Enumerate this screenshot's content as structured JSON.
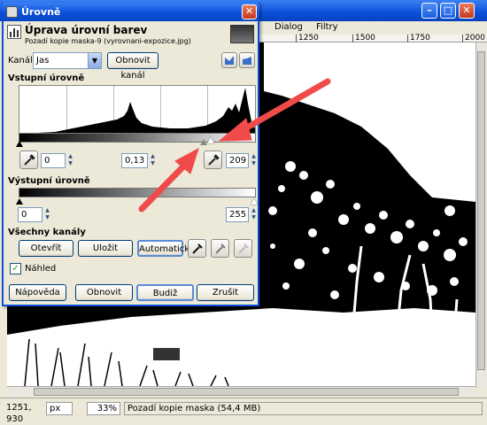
{
  "bg_window": {
    "menu": [
      "Dialog",
      "Filtry"
    ],
    "ruler_ticks": [
      "1250",
      "1500",
      "1750",
      "2000"
    ],
    "status": {
      "coords": "1251, 930",
      "unit": "px",
      "zoom": "33%",
      "message": "Pozadí kopie maska (54,4 MB)"
    }
  },
  "dialog": {
    "window_title": "Úrovně",
    "heading": "Úprava úrovní barev",
    "subheading": "Pozadí kopie maska-9 (vyrovnani-expozice.jpg)",
    "channel_label": "Kanál:",
    "channel_value": "Jas",
    "reset_channel": "Obnovit kanál",
    "input_section": "Vstupní úrovně",
    "input_low": "0",
    "input_gamma": "0,13",
    "input_high": "209",
    "output_section": "Výstupní úrovně",
    "output_low": "0",
    "output_high": "255",
    "all_channels_section": "Všechny kanály",
    "open_label": "Otevřít",
    "save_label": "Uložit",
    "auto_label": "Automaticky",
    "preview_label": "Náhled",
    "preview_checked": true,
    "help_label": "Nápověda",
    "reset_label": "Obnovit",
    "ok_label": "Budiž",
    "cancel_label": "Zrušit"
  },
  "colors": {
    "titlebar": "#0a4fd8",
    "annotation_arrow": "#f04a4a",
    "dialog_bg": "#ece9d8"
  }
}
